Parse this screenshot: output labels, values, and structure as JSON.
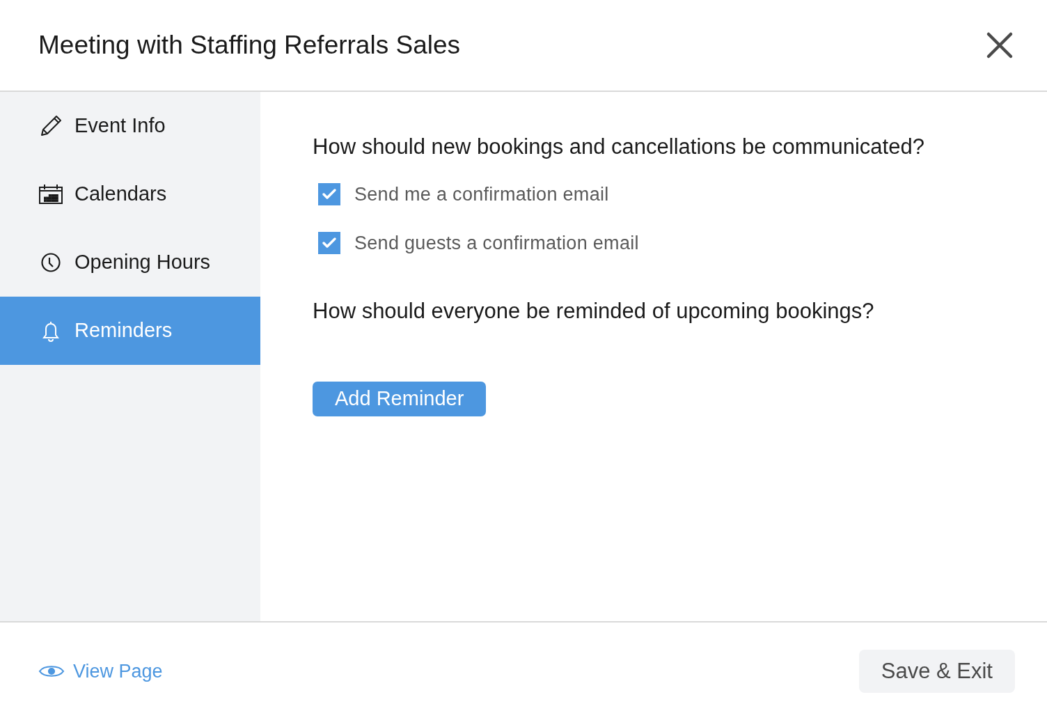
{
  "dialog": {
    "title": "Meeting with Staffing Referrals Sales"
  },
  "sidebar": {
    "items": [
      {
        "label": "Event Info",
        "selected": false
      },
      {
        "label": "Calendars",
        "selected": false
      },
      {
        "label": "Opening Hours",
        "selected": false
      },
      {
        "label": "Reminders",
        "selected": true
      }
    ]
  },
  "content": {
    "communication_question": "How should new bookings and cancellations be communicated?",
    "options": [
      {
        "label": "Send me a confirmation email",
        "checked": true
      },
      {
        "label": "Send guests a confirmation email",
        "checked": true
      }
    ],
    "reminder_question": "How should everyone be reminded of upcoming bookings?",
    "add_button": "Add Reminder"
  },
  "footer": {
    "view_link": "View Page",
    "save_button": "Save & Exit"
  }
}
